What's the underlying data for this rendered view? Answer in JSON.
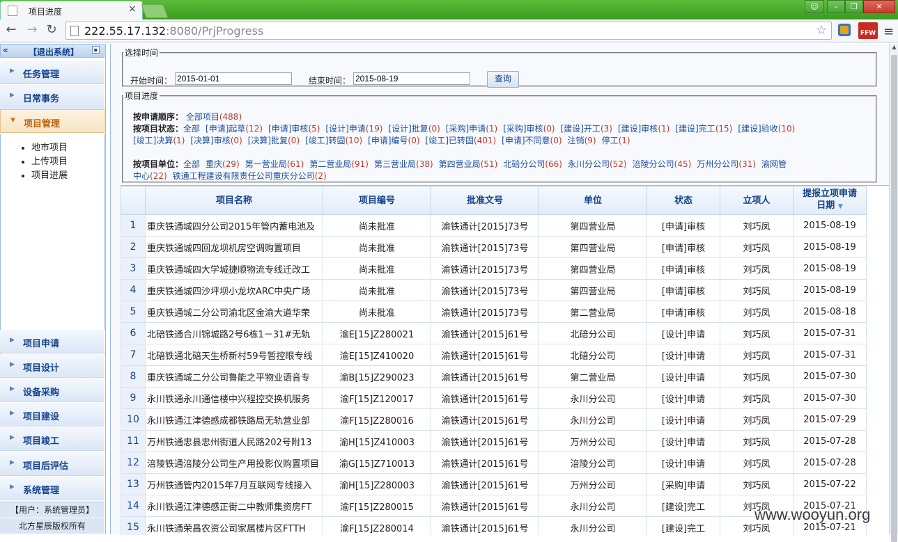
{
  "browser": {
    "tab_title": "项目进度",
    "url_host": "222.55.17.132",
    "url_rest": ":8080/PrjProgress",
    "ext_label": "FFW"
  },
  "sidebar": {
    "logout": "【退出系统】",
    "menu": [
      "任务管理",
      "日常事务",
      "项目管理",
      "项目申请",
      "项目设计",
      "设备采购",
      "项目建设",
      "项目竣工",
      "项目后评估",
      "系统管理"
    ],
    "submenu": [
      "地市项目",
      "上传项目",
      "项目进展"
    ],
    "user": "【用户：系统管理员】",
    "copyright": "北方星辰版权所有"
  },
  "time_filter": {
    "legend": "选择时间",
    "start_label": "开始时间：",
    "start_value": "2015-01-01",
    "end_label": "结束时间：",
    "end_value": "2015-08-19",
    "query": "查询"
  },
  "progress": {
    "legend": "项目进度",
    "order_label": "按申请顺序：",
    "order_links": [
      {
        "t": "全部项目",
        "n": "(488)"
      }
    ],
    "status_label": "按项目状态：",
    "status_links": [
      {
        "t": "全部",
        "n": ""
      },
      {
        "t": "[申请]起草",
        "n": "(12)"
      },
      {
        "t": "[申请]审核",
        "n": "(5)"
      },
      {
        "t": "[设计]申请",
        "n": "(19)"
      },
      {
        "t": "[设计]批复",
        "n": "(0)"
      },
      {
        "t": "[采购]申请",
        "n": "(1)"
      },
      {
        "t": "[采购]审核",
        "n": "(0)"
      },
      {
        "t": "[建设]开工",
        "n": "(3)"
      },
      {
        "t": "[建设]审核",
        "n": "(1)"
      },
      {
        "t": "[建设]完工",
        "n": "(15)"
      },
      {
        "t": "[建设]验收",
        "n": "(10)"
      }
    ],
    "status_links2": [
      {
        "t": "[竣工]决算",
        "n": "(1)"
      },
      {
        "t": "[决算]审核",
        "n": "(0)"
      },
      {
        "t": "[决算]批复",
        "n": "(0)"
      },
      {
        "t": "[竣工]转固",
        "n": "(10)"
      },
      {
        "t": "[申请]编号",
        "n": "(0)"
      },
      {
        "t": "[竣工]已转固",
        "n": "(401)"
      },
      {
        "t": "[申请]不同意",
        "n": "(0)"
      },
      {
        "t": "注销",
        "n": "(9)"
      },
      {
        "t": "停工",
        "n": "(1)"
      }
    ],
    "unit_label": "按项目单位：",
    "unit_links": [
      {
        "t": "全部",
        "n": ""
      },
      {
        "t": "重庆",
        "n": "(29)"
      },
      {
        "t": "第一营业局",
        "n": "(61)"
      },
      {
        "t": "第二营业局",
        "n": "(91)"
      },
      {
        "t": "第三营业局",
        "n": "(38)"
      },
      {
        "t": "第四营业局",
        "n": "(51)"
      },
      {
        "t": "北碚分公司",
        "n": "(66)"
      },
      {
        "t": "永川分公司",
        "n": "(52)"
      },
      {
        "t": "涪陵分公司",
        "n": "(45)"
      },
      {
        "t": "万州分公司",
        "n": "(31)"
      },
      {
        "t": "渝网管",
        "n": ""
      }
    ],
    "unit_links2": [
      {
        "t": "中心",
        "n": "(22)"
      },
      {
        "t": "铁通工程建设有限责任公司重庆分公司",
        "n": "(2)"
      }
    ]
  },
  "grid": {
    "headers": [
      "项目名称",
      "项目编号",
      "批准文号",
      "单位",
      "状态",
      "立项人",
      "提报立项申请",
      "日期"
    ],
    "rows": [
      [
        "1",
        "重庆铁通城四分公司2015年管内蓄电池及",
        "尚未批准",
        "渝铁通计[2015]73号",
        "第四营业局",
        "[申请]审核",
        "刘巧凤",
        "2015-08-19"
      ],
      [
        "2",
        "重庆铁通城四回龙坝机房空调购置项目",
        "尚未批准",
        "渝铁通计[2015]73号",
        "第四营业局",
        "[申请]审核",
        "刘巧凤",
        "2015-08-19"
      ],
      [
        "3",
        "重庆铁通城四大学城捷顺物流专线迁改工",
        "尚未批准",
        "渝铁通计[2015]73号",
        "第四营业局",
        "[申请]审核",
        "刘巧凤",
        "2015-08-19"
      ],
      [
        "4",
        "重庆铁通城四沙坪坝小龙坎ARC中央广场",
        "尚未批准",
        "渝铁通计[2015]73号",
        "第四营业局",
        "[申请]审核",
        "刘巧凤",
        "2015-08-19"
      ],
      [
        "5",
        "重庆铁通城二分公司渝北区金渝大道华荣",
        "尚未批准",
        "渝铁通计[2015]73号",
        "第二营业局",
        "[申请]审核",
        "刘巧凤",
        "2015-08-18"
      ],
      [
        "6",
        "北碚铁通合川锦城路2号6栋1－31#无轨",
        "渝E[15]Z280021",
        "渝铁通计[2015]61号",
        "北碚分公司",
        "[设计]申请",
        "刘巧凤",
        "2015-07-31"
      ],
      [
        "7",
        "北碚铁通北碚天生桥新村59号暂控眼专线",
        "渝E[15]Z410020",
        "渝铁通计[2015]61号",
        "北碚分公司",
        "[设计]申请",
        "刘巧凤",
        "2015-07-31"
      ],
      [
        "8",
        "重庆铁通城二分公司鲁能之平物业语音专",
        "渝B[15]Z290023",
        "渝铁通计[2015]61号",
        "第二营业局",
        "[设计]申请",
        "刘巧凤",
        "2015-07-30"
      ],
      [
        "9",
        "永川铁通永川通信楼中兴程控交换机服务",
        "渝F[15]Z120017",
        "渝铁通计[2015]61号",
        "永川分公司",
        "[设计]申请",
        "刘巧凤",
        "2015-07-30"
      ],
      [
        "10",
        "永川铁通江津德感成都铁路局无轨营业部",
        "渝F[15]Z280016",
        "渝铁通计[2015]61号",
        "永川分公司",
        "[设计]申请",
        "刘巧凤",
        "2015-07-29"
      ],
      [
        "11",
        "万州铁通忠县忠州街道人民路202号附13",
        "渝H[15]Z410003",
        "渝铁通计[2015]61号",
        "万州分公司",
        "[设计]申请",
        "刘巧凤",
        "2015-07-28"
      ],
      [
        "12",
        "涪陵铁通涪陵分公司生产用投影仪购置项目",
        "渝G[15]Z710013",
        "渝铁通计[2015]61号",
        "涪陵分公司",
        "[设计]申请",
        "刘巧凤",
        "2015-07-28"
      ],
      [
        "13",
        "万州铁通管内2015年7月互联网专线接入",
        "渝H[15]Z280003",
        "渝铁通计[2015]61号",
        "万州分公司",
        "[采购]申请",
        "刘巧凤",
        "2015-07-22"
      ],
      [
        "14",
        "永川铁通江津德感正街二中教师集资房FT",
        "渝F[15]Z280015",
        "渝铁通计[2015]61号",
        "永川分公司",
        "[建设]完工",
        "刘巧凤",
        "2015-07-21"
      ],
      [
        "15",
        "永川铁通荣昌农资公司家属楼片区FTTH",
        "渝F[15]Z280014",
        "渝铁通计[2015]61号",
        "永川分公司",
        "[建设]完工",
        "刘巧凤",
        "2015-07-21"
      ]
    ]
  },
  "watermark": "www.wooyun.org"
}
